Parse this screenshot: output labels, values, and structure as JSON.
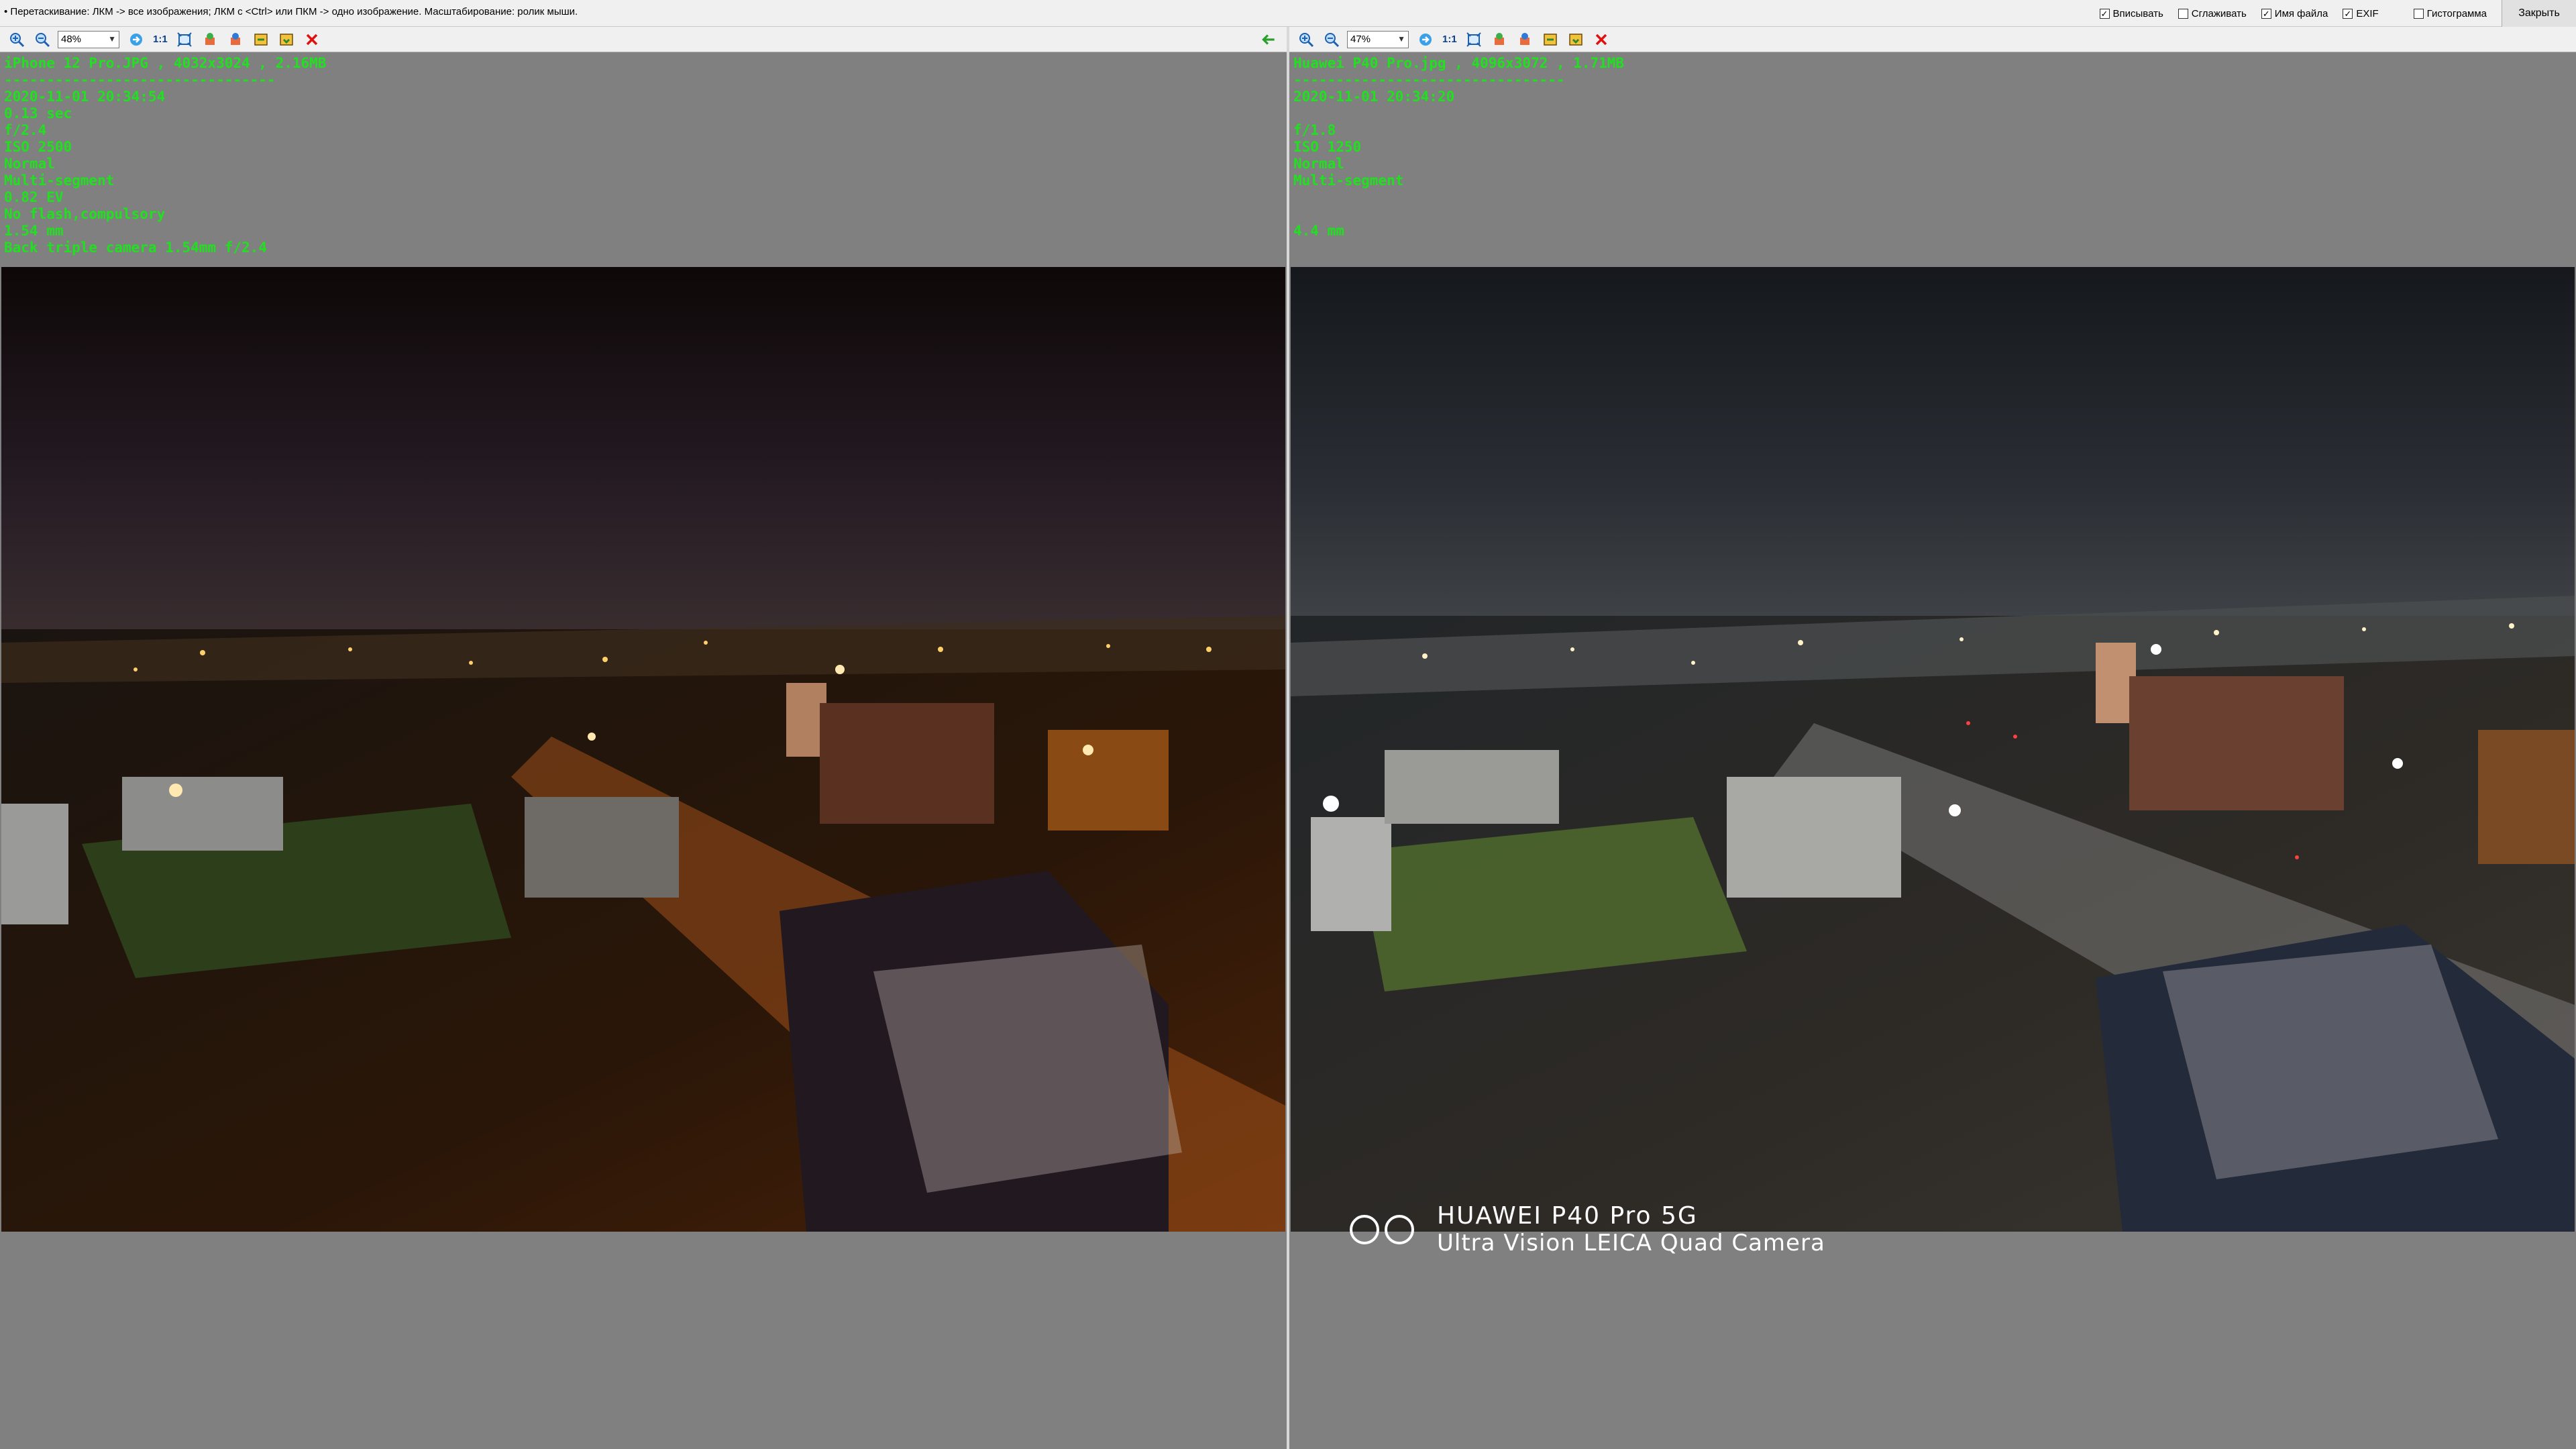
{
  "topbar": {
    "hint": "• Перетаскивание: ЛКМ -> все изображения; ЛКМ с <Ctrl> или ПКМ -> одно изображение. Масштабирование: ролик мыши.",
    "options": [
      {
        "label": "Вписывать",
        "checked": true
      },
      {
        "label": "Сглаживать",
        "checked": false
      },
      {
        "label": "Имя файла",
        "checked": true
      },
      {
        "label": "EXIF",
        "checked": true
      },
      {
        "label": "Гистограмма",
        "checked": false
      }
    ],
    "close_label": "Закрыть"
  },
  "toolbar_common": {
    "icons": [
      "zoom-in-icon",
      "zoom-out-icon",
      "fit-arrow-icon",
      "one-to-one",
      "fit-screen-icon",
      "rotate-left-icon",
      "rotate-right-icon",
      "flip-icon",
      "save-icon",
      "delete-icon"
    ],
    "one_to_one_label": "1:1"
  },
  "left": {
    "zoom": "48%",
    "exif": [
      "iPhone 12 Pro.JPG , 4032x3024 , 2.16MB",
      "--------------------------------",
      "2020-11-01 20:34:54",
      "0.13 sec",
      "f/2.4",
      "ISO 2500",
      "Normal",
      "Multi-segment",
      "0.82 EV",
      "No flash,compulsory",
      "1.54 mm",
      "Back triple camera 1.54mm f/2.4"
    ]
  },
  "right": {
    "zoom": "47%",
    "exif": [
      "Huawei P40 Pro.jpg , 4096x3072 , 1.71MB",
      "--------------------------------",
      "2020-11-01 20:34:20",
      "",
      "f/1.8",
      "ISO 1250",
      "Normal",
      "Multi-segment",
      "",
      "",
      "4.4 mm"
    ],
    "watermark": {
      "line1": "HUAWEI P40 Pro 5G",
      "line2": "Ultra Vision LEICA Quad Camera"
    }
  },
  "colors": {
    "exif_text": "#20e020",
    "background": "#808080"
  }
}
